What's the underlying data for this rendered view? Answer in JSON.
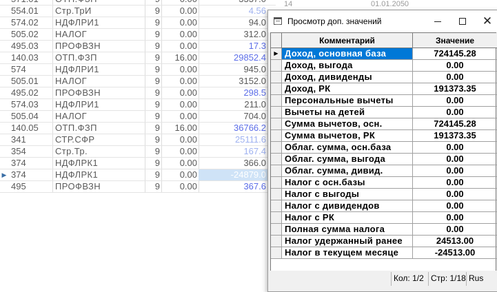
{
  "background_table": {
    "cut_row": {
      "code": "571.01",
      "name": "ОТП.ФЗП",
      "n": "9",
      "rate": "0.00",
      "amount": "3337.0"
    },
    "rows": [
      {
        "code": "554.01",
        "name": "Стр.ТрИ",
        "n": "9",
        "rate": "0.00",
        "amount": "4.56",
        "amount_color": "#9fb2f0",
        "marker": ""
      },
      {
        "code": "574.02",
        "name": "НДФЛРИ1",
        "n": "9",
        "rate": "0.00",
        "amount": "94.0",
        "amount_color": "#5a5a5a",
        "marker": ""
      },
      {
        "code": "505.02",
        "name": "НАЛОГ",
        "n": "9",
        "rate": "0.00",
        "amount": "312.0",
        "amount_color": "#5a5a5a",
        "marker": ""
      },
      {
        "code": "495.03",
        "name": "ПРОФВЗН",
        "n": "9",
        "rate": "0.00",
        "amount": "17.3",
        "amount_color": "#5c6ee8",
        "marker": ""
      },
      {
        "code": "140.03",
        "name": "ОТП.ФЗП",
        "n": "9",
        "rate": "16.00",
        "amount": "29852.4",
        "amount_color": "#5c6ee8",
        "marker": ""
      },
      {
        "code": "574",
        "name": "НДФЛРИ1",
        "n": "9",
        "rate": "0.00",
        "amount": "945.0",
        "amount_color": "#5a5a5a",
        "marker": ""
      },
      {
        "code": "505.01",
        "name": "НАЛОГ",
        "n": "9",
        "rate": "0.00",
        "amount": "3152.0",
        "amount_color": "#5a5a5a",
        "marker": ""
      },
      {
        "code": "495.02",
        "name": "ПРОФВЗН",
        "n": "9",
        "rate": "0.00",
        "amount": "298.5",
        "amount_color": "#5c6ee8",
        "marker": ""
      },
      {
        "code": "574.03",
        "name": "НДФЛРИ1",
        "n": "9",
        "rate": "0.00",
        "amount": "211.0",
        "amount_color": "#5a5a5a",
        "marker": ""
      },
      {
        "code": "505.04",
        "name": "НАЛОГ",
        "n": "9",
        "rate": "0.00",
        "amount": "704.0",
        "amount_color": "#5a5a5a",
        "marker": ""
      },
      {
        "code": "140.05",
        "name": "ОТП.ФЗП",
        "n": "9",
        "rate": "16.00",
        "amount": "36766.2",
        "amount_color": "#5c6ee8",
        "marker": ""
      },
      {
        "code": "341",
        "name": "СТР.СФР",
        "n": "9",
        "rate": "0.00",
        "amount": "25111.6",
        "amount_color": "#9fb2f0",
        "marker": ""
      },
      {
        "code": "354",
        "name": "Стр.Тр.",
        "n": "9",
        "rate": "0.00",
        "amount": "167.4",
        "amount_color": "#9fb2f0",
        "marker": ""
      },
      {
        "code": "374",
        "name": "НДФЛРК1",
        "n": "9",
        "rate": "0.00",
        "amount": "366.0",
        "amount_color": "#5a5a5a",
        "marker": ""
      },
      {
        "code": "374",
        "name": "НДФЛРК1",
        "n": "9",
        "rate": "0.00",
        "amount": "-24879.0",
        "amount_color": "#ffffff",
        "marker": "▶",
        "highlight": true
      },
      {
        "code": "495",
        "name": "ПРОФВЗН",
        "n": "9",
        "rate": "0.00",
        "amount": "367.6",
        "amount_color": "#5c6ee8",
        "marker": ""
      }
    ],
    "right_top": {
      "left": "14",
      "right": "01.01.2050"
    }
  },
  "dialog": {
    "title": "Просмотр доп. значений",
    "close_glyph": "✕",
    "columns": {
      "comment": "Комментарий",
      "value": "Значение"
    },
    "current_marker": "▶",
    "rows": [
      {
        "comment": "Доход, основная база",
        "value": "724145.28"
      },
      {
        "comment": "Доход, выгода",
        "value": "0.00"
      },
      {
        "comment": "Доход, дивиденды",
        "value": "0.00"
      },
      {
        "comment": "Доход, РК",
        "value": "191373.35"
      },
      {
        "comment": "Персональные вычеты",
        "value": "0.00"
      },
      {
        "comment": "Вычеты на детей",
        "value": "0.00"
      },
      {
        "comment": "Сумма вычетов, осн.",
        "value": "724145.28"
      },
      {
        "comment": "Сумма вычетов, РК",
        "value": "191373.35"
      },
      {
        "comment": "Облаг. сумма, осн.база",
        "value": "0.00"
      },
      {
        "comment": "Облаг. сумма, выгода",
        "value": "0.00"
      },
      {
        "comment": "Облаг. сумма, дивид.",
        "value": "0.00"
      },
      {
        "comment": "Налог с осн.базы",
        "value": "0.00"
      },
      {
        "comment": "Налог с выгоды",
        "value": "0.00"
      },
      {
        "comment": "Налог с дивидендов",
        "value": "0.00"
      },
      {
        "comment": "Налог с РК",
        "value": "0.00"
      },
      {
        "comment": "Полная сумма налога",
        "value": "0.00"
      },
      {
        "comment": "Налог удержанный ранее",
        "value": "24513.00"
      },
      {
        "comment": "Налог в текущем месяце",
        "value": "-24513.00"
      }
    ],
    "status": {
      "position": "Кол: 1/2",
      "page": "Стр: 1/18",
      "lang": "Rus"
    }
  },
  "colors": {
    "selection": "#0078d7",
    "highlight_row": "#cfe3f7"
  }
}
